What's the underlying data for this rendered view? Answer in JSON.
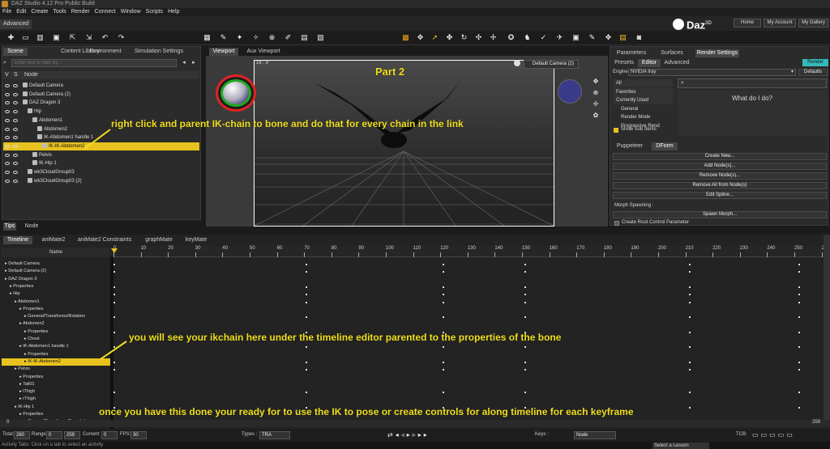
{
  "app": {
    "title": "DAZ Studio 4.12 Pro Public Build",
    "brand": "Daz",
    "brand_sup": "3D"
  },
  "menu": [
    "File",
    "Edit",
    "Create",
    "Tools",
    "Render",
    "Connect",
    "Window",
    "Scripts",
    "Help"
  ],
  "layout_tab": "Advanced",
  "header_buttons": [
    "Home",
    "My Account",
    "My Gallery"
  ],
  "scene_panel": {
    "tabs": [
      "Scene",
      "Content Library",
      "Environment",
      "Simulation Settings"
    ],
    "filter_placeholder": "Enter text to filter by...",
    "columns": [
      "V",
      "S",
      "Node"
    ],
    "nodes": [
      {
        "label": "Default Camera",
        "indent": 0
      },
      {
        "label": "Default Camera (2)",
        "indent": 0
      },
      {
        "label": "DAZ Dragon 3",
        "indent": 0
      },
      {
        "label": "Hip",
        "indent": 1
      },
      {
        "label": "Abdomen1",
        "indent": 2
      },
      {
        "label": "Abdomen2",
        "indent": 3
      },
      {
        "label": "IK-Abdomen1 handle 1",
        "indent": 3
      },
      {
        "label": "IK-IK-Abdomen2",
        "indent": 4,
        "selected": true
      },
      {
        "label": "Pelvis",
        "indent": 2
      },
      {
        "label": "IK-Hip 1",
        "indent": 2
      },
      {
        "label": "wk3CloudGroup03",
        "indent": 1
      },
      {
        "label": "wk3CloudGroup03 (2)",
        "indent": 1
      }
    ],
    "bottom_tabs": [
      "Tips",
      "Node"
    ]
  },
  "viewport": {
    "tabs": [
      "Viewport",
      "Aux Viewport"
    ],
    "aspect": "16 : 9",
    "camera": "Default Camera (2)",
    "part_label": "Part 2"
  },
  "right_panel": {
    "tabs": [
      "Parameters",
      "Surfaces",
      "Render Settings"
    ],
    "subtabs": [
      "Presets",
      "Editor",
      "Advanced"
    ],
    "render_btn": "Render",
    "engine_label": "Engine :",
    "engine_value": "NVIDIA Iray",
    "defaults": "Defaults",
    "categories": [
      "All",
      "Favorites",
      "Currently Used",
      "General",
      "Render Mode",
      "Progressive Rend"
    ],
    "show_sub_items": "Show Sub Items",
    "help_title": "What do I do?",
    "tabs2": [
      "Puppeteer",
      "DForm"
    ],
    "dform_buttons": [
      "Create New...",
      "Add Node(s)...",
      "Remove Node(s)...",
      "Remove All from Node(s)",
      "Edit Spline..."
    ],
    "morph_spawning": "Morph Spawning :",
    "spawn_morph": "Spawn Morph...",
    "create_root": "Create Root Control Parameter"
  },
  "timeline": {
    "tabs": [
      "Timeline",
      "aniMate2",
      "aniMate2 Constraints",
      "graphMate",
      "keyMate"
    ],
    "name_header": "Name",
    "ticks": [
      "0",
      "10",
      "20",
      "30",
      "40",
      "50",
      "60",
      "70",
      "80",
      "90",
      "100",
      "110",
      "120",
      "130",
      "140",
      "150",
      "160",
      "170",
      "180",
      "190",
      "200",
      "210",
      "220",
      "230",
      "240",
      "250",
      "259"
    ],
    "tracks": [
      {
        "label": "Default Camera",
        "indent": 0
      },
      {
        "label": "Default Camera (2)",
        "indent": 0
      },
      {
        "label": "DAZ Dragon 3",
        "indent": 0
      },
      {
        "label": "Properties",
        "indent": 1
      },
      {
        "label": "Hip",
        "indent": 1
      },
      {
        "label": "Abdomen1",
        "indent": 2
      },
      {
        "label": "Properties",
        "indent": 3
      },
      {
        "label": "General/Transforms/Rotation",
        "indent": 4
      },
      {
        "label": "Abdomen2",
        "indent": 3
      },
      {
        "label": "Properties",
        "indent": 4
      },
      {
        "label": "Chest",
        "indent": 4
      },
      {
        "label": "IK-Abdomen1 handle 1",
        "indent": 3
      },
      {
        "label": "Properties",
        "indent": 4
      },
      {
        "label": "IK-IK-Abdomen2",
        "indent": 4,
        "selected": true
      },
      {
        "label": "Pelvis",
        "indent": 2
      },
      {
        "label": "Properties",
        "indent": 3
      },
      {
        "label": "Tail01",
        "indent": 3
      },
      {
        "label": "lThigh",
        "indent": 3
      },
      {
        "label": "rThigh",
        "indent": 3
      },
      {
        "label": "IK-Hip 1",
        "indent": 2
      },
      {
        "label": "Properties",
        "indent": 3
      },
      {
        "label": "General/Transforms/Translation",
        "indent": 4
      }
    ],
    "range_start": "0",
    "range_end": "259"
  },
  "status": {
    "total_label": "Total:",
    "total": "260",
    "range_label": "Range:",
    "range_a": "0",
    "range_b": "259",
    "current_label": "Current:",
    "current": "0",
    "fps_label": "FPS:",
    "fps": "30",
    "types_label": "Types :",
    "types": "TRA",
    "keys_label": "Keys :",
    "keys": "Node",
    "tcb_label": "TCB:"
  },
  "activity_text": "Activity Tabs: Click on a tab to select an activity",
  "lesson_select": "Select a Lesson",
  "annotations": {
    "a1": "right click and parent IK-chain to bone and do that for every chain in the link",
    "a2": "you will see your ikchain here under the timeline editor parented to the properties of the bone",
    "a3": "once you have this done your ready for to use the IK to pose or create controls for along timeline for each keyframe"
  },
  "colors": {
    "accent": "#e8c21e",
    "annotation": "#f0e020",
    "panel": "#2b2b2b"
  }
}
